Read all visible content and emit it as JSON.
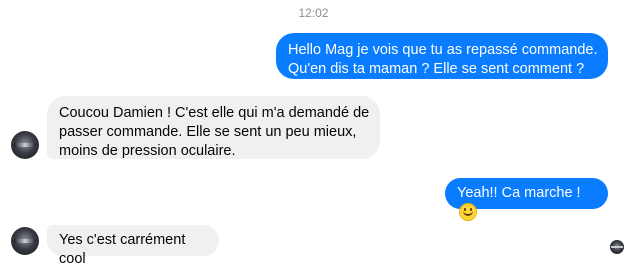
{
  "timestamp": "12:02",
  "messages": [
    {
      "direction": "outgoing",
      "lines": [
        "Hello Mag je vois que tu as repassé commande.",
        "Qu'en dis ta maman ? Elle se sent comment ?"
      ]
    },
    {
      "direction": "incoming",
      "lines": [
        "Coucou Damien ! C'est elle qui m'a demandé de",
        "passer commande. Elle se sent un peu mieux,",
        "moins de pression oculaire."
      ]
    },
    {
      "direction": "outgoing",
      "text": "Yeah!! Ca marche !",
      "emoji": "slightly-smiling-face-icon"
    },
    {
      "direction": "incoming",
      "text": "Yes c'est carrément cool"
    }
  ],
  "colors": {
    "outgoing_bubble": "#0a7cff",
    "incoming_bubble": "#f0f0f0",
    "timestamp": "#8a8d91"
  }
}
